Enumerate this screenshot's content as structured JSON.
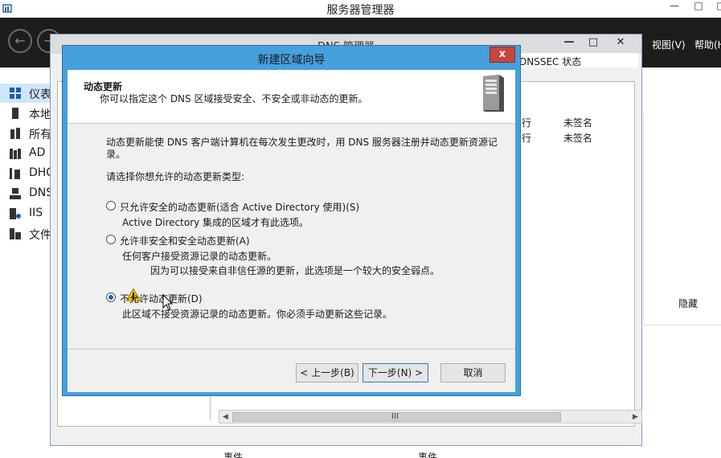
{
  "server_manager": {
    "title": "服务器管理器",
    "menu": [
      "视图(V)",
      "帮助(H"
    ],
    "nav_items": [
      {
        "label": "仪表",
        "icon": "dashboard-icon",
        "selected": true
      },
      {
        "label": "本地",
        "icon": "server-icon",
        "selected": false
      },
      {
        "label": "所有",
        "icon": "servers-icon",
        "selected": false
      },
      {
        "label": "AD I",
        "icon": "ad-icon",
        "selected": false
      },
      {
        "label": "DHC",
        "icon": "dhcp-icon",
        "selected": false
      },
      {
        "label": "DNS",
        "icon": "dns-icon",
        "selected": false
      },
      {
        "label": "IIS",
        "icon": "iis-icon",
        "selected": false
      },
      {
        "label": "文件",
        "icon": "file-services-icon",
        "selected": false
      }
    ],
    "hide_label": "隐藏",
    "events": [
      "事件",
      "事件"
    ]
  },
  "dns_manager": {
    "title": "DNS 管理器",
    "column_header": "DNSSEC 状态",
    "rows": [
      {
        "frag": "行",
        "status": "未签名"
      },
      {
        "frag": "行",
        "status": "未签名"
      }
    ],
    "scroll_grip": "III"
  },
  "wizard": {
    "title": "新建区域向导",
    "close": "x",
    "header_title": "动态更新",
    "header_desc": "你可以指定这个 DNS 区域接受安全、不安全或非动态的更新。",
    "intro_line1": "动态更新能使 DNS 客户端计算机在每次发生更改时，用 DNS 服务器注册并动态更新资源记",
    "intro_line2": "录。",
    "prompt": "请选择你想允许的动态更新类型:",
    "options": [
      {
        "label": "只允许安全的动态更新(适合 Active Directory 使用)(S)",
        "desc": "Active Directory 集成的区域才有此选项。",
        "checked": false
      },
      {
        "label": "允许非安全和安全动态更新(A)",
        "desc": "任何客户接受资源记录的动态更新。",
        "checked": false
      },
      {
        "label": "不允许动态更新(D)",
        "desc": "此区域不接受资源记录的动态更新。你必须手动更新这些记录。",
        "checked": true
      }
    ],
    "warning": "因为可以接受来自非信任源的更新，此选项是一个较大的安全弱点。",
    "buttons": {
      "back": "< 上一步(B)",
      "next": "下一步(N) >",
      "cancel": "取消"
    }
  }
}
